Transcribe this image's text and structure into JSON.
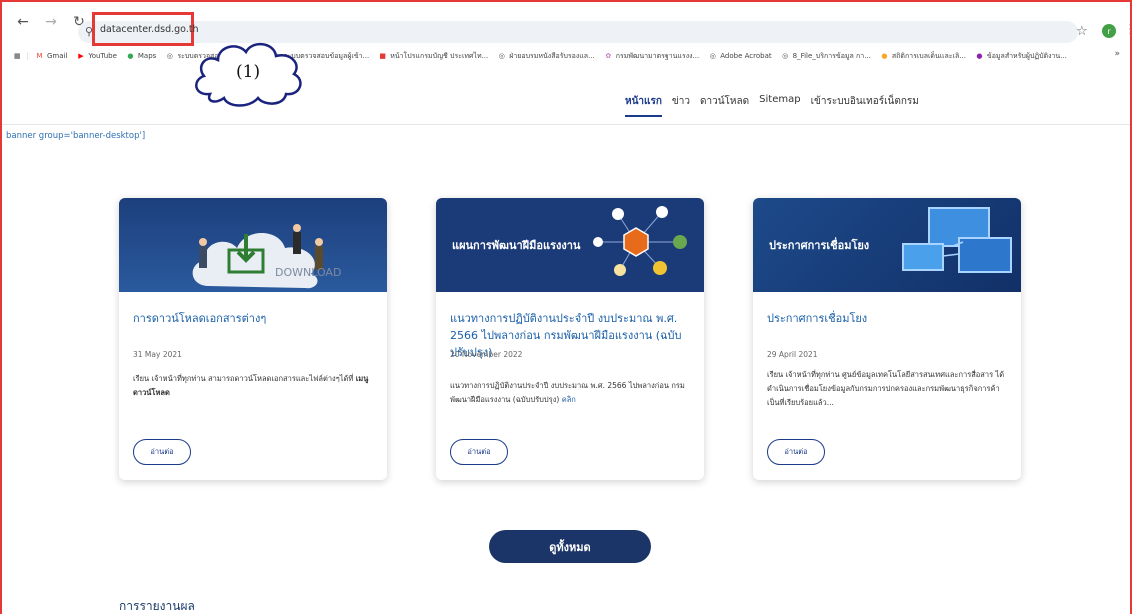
{
  "browser": {
    "url": "datacenter.dsd.go.th",
    "profile_initial": "r"
  },
  "bookmarks": [
    {
      "label": "Gmail",
      "icon": "gmail-icon",
      "color": "#ea4335",
      "glyph": "M"
    },
    {
      "label": "YouTube",
      "icon": "youtube-icon",
      "color": "#ff0000",
      "glyph": "▶"
    },
    {
      "label": "Maps",
      "icon": "maps-icon",
      "color": "#34a853",
      "glyph": "●"
    },
    {
      "label": "ระบบตรวจสอบข้อมูลผู้เข้า...",
      "icon": "globe-icon",
      "color": "#555555",
      "glyph": "◎"
    },
    {
      "label": "ระบบตรวจสอบข้อมูลผู้เข้า...",
      "icon": "globe-icon",
      "color": "#555555",
      "glyph": "◎"
    },
    {
      "label": "หน้าโปรแกรมบัญชี ประเทศไท...",
      "icon": "red-square-icon",
      "color": "#e53935",
      "glyph": "■"
    },
    {
      "label": "ฝ่ายอบรมหนังสือรับรองแล...",
      "icon": "globe-icon",
      "color": "#555555",
      "glyph": "◎"
    },
    {
      "label": "กรมพัฒนามาตรฐานแรงง...",
      "icon": "dsd-icon",
      "color": "#c77dba",
      "glyph": "✿"
    },
    {
      "label": "Adobe Acrobat",
      "icon": "globe-icon",
      "color": "#555555",
      "glyph": "◎"
    },
    {
      "label": "8_File_บริการข้อมูล กา...",
      "icon": "globe-icon",
      "color": "#555555",
      "glyph": "◎"
    },
    {
      "label": "สถิติการเบลเด็นเเละเลิ...",
      "icon": "bulb-icon",
      "color": "#f9a825",
      "glyph": "●"
    },
    {
      "label": "ข้อมูลสำหรับผู้ปฏิบัติงาน...",
      "icon": "purple-icon",
      "color": "#8e24aa",
      "glyph": "●"
    }
  ],
  "annotation": {
    "label": "(1)"
  },
  "site_nav": {
    "items": [
      "หน้าแรก",
      "ข่าว",
      "ดาวน์โหลด",
      "Sitemap",
      "เข้าระบบอินเทอร์เน็ตกรม"
    ]
  },
  "banner_text": "banner group='banner-desktop']",
  "cards": [
    {
      "image_text": "DOWNLOAD",
      "title": "การดาวน์โหลดเอกสารต่างๆ",
      "date": "31 May 2021",
      "desc_plain": "เรียน เจ้าหน้าที่ทุกท่าน สามารถดาวน์โหลดเอกสารและไฟล์ต่างๆได้ที่ ",
      "desc_bold": "เมนู ดาวน์โหลด",
      "read_more": "อ่านต่อ"
    },
    {
      "image_text": "แผนการพัฒนาฝีมือแรงงาน",
      "title": "แนวทางการปฏิบัติงานประจำปี งบประมาณ พ.ศ. 2566 ไปพลางก่อน กรมพัฒนาฝีมือแรงงาน (ฉบับปรับปรุง)",
      "date": "20 November 2022",
      "desc_plain": "แนวทางการปฏิบัติงานประจำปี งบประมาณ พ.ศ. 2566 ไปพลางก่อน กรมพัฒนาฝีมือแรงงาน (ฉบับปรับปรุง) ",
      "desc_link": "คลิก",
      "read_more": "อ่านต่อ"
    },
    {
      "image_text": "ประกาศการเชื่อมโยง",
      "title": "ประกาศการเชื่อมโยง",
      "date": "29 April 2021",
      "desc_plain": "เรียน เจ้าหน้าที่ทุกท่าน ศูนย์ข้อมูลเทคโนโลยีสารสนเทศและการสื่อสาร ได้ดำเนินการเชื่อมโยงข้อมูลกับกรมการปกครองและกรมพัฒนาธุรกิจการค้าเป็นที่เรียบร้อยแล้ว...",
      "read_more": "อ่านต่อ"
    }
  ],
  "view_all": "ดูทั้งหมด",
  "section_title": "การรายงานผล",
  "colors": {
    "accent": "#1b3568",
    "annotation": "#e53935",
    "link": "#1a5fa8"
  }
}
